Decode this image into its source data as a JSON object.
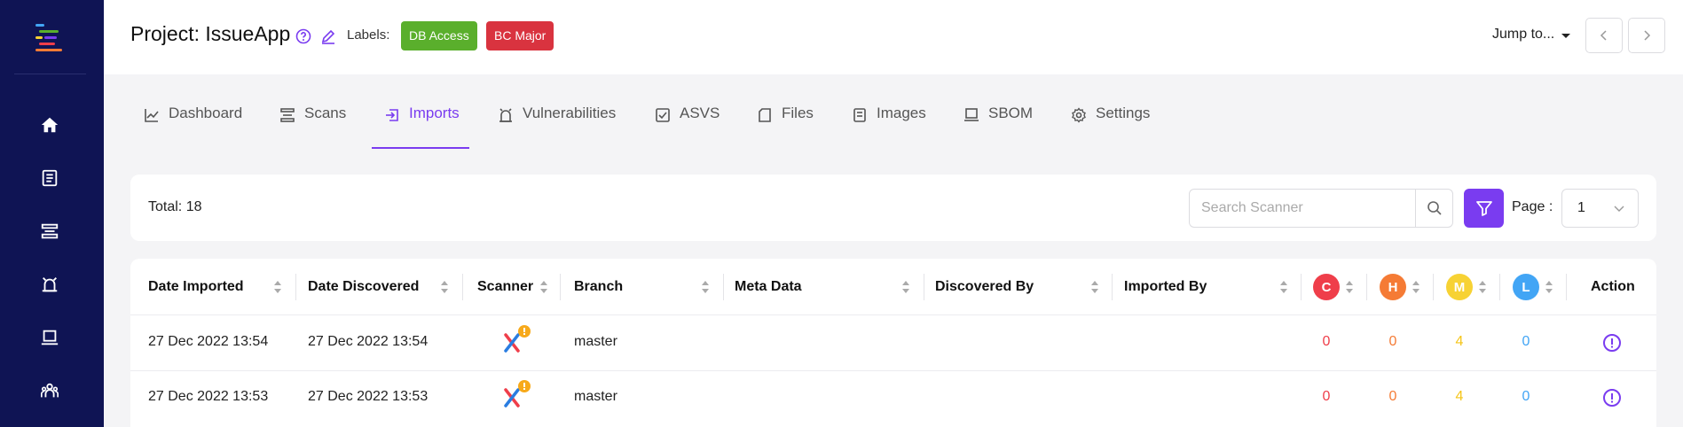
{
  "header": {
    "project_title": "Project: IssueApp",
    "labels_text": "Labels:",
    "badges": [
      {
        "label": "DB Access",
        "color": "#5aaf2c"
      },
      {
        "label": "BC Major",
        "color": "#d9333f"
      }
    ],
    "jump_to": "Jump to..."
  },
  "sidebar": {
    "icons": [
      "home-icon",
      "document-icon",
      "scans-icon",
      "vulnerability-icon",
      "laptop-icon",
      "team-icon"
    ]
  },
  "tabs": [
    {
      "label": "Dashboard",
      "icon": "chart-line-icon"
    },
    {
      "label": "Scans",
      "icon": "scans-icon"
    },
    {
      "label": "Imports",
      "icon": "import-icon",
      "active": true
    },
    {
      "label": "Vulnerabilities",
      "icon": "bug-icon"
    },
    {
      "label": "ASVS",
      "icon": "checkbox-icon"
    },
    {
      "label": "Files",
      "icon": "file-icon"
    },
    {
      "label": "Images",
      "icon": "image-icon"
    },
    {
      "label": "SBOM",
      "icon": "laptop-icon"
    },
    {
      "label": "Settings",
      "icon": "gear-icon"
    }
  ],
  "toolbar": {
    "total": "Total: 18",
    "search_placeholder": "Search Scanner",
    "page_label": "Page :",
    "page_value": "1"
  },
  "table": {
    "columns": [
      "Date Imported",
      "Date Discovered",
      "Scanner",
      "Branch",
      "Meta Data",
      "Discovered By",
      "Imported By",
      "C",
      "H",
      "M",
      "L",
      "Action"
    ],
    "severity_colors": {
      "C": "#ef3e4a",
      "H": "#f57b35",
      "M": "#f7d234",
      "L": "#42a5f5"
    },
    "rows": [
      {
        "date_imported": "27 Dec 2022 13:54",
        "date_discovered": "27 Dec 2022 13:54",
        "branch": "master",
        "c": "0",
        "h": "0",
        "m": "4",
        "l": "0"
      },
      {
        "date_imported": "27 Dec 2022 13:53",
        "date_discovered": "27 Dec 2022 13:53",
        "branch": "master",
        "c": "0",
        "h": "0",
        "m": "4",
        "l": "0"
      }
    ]
  },
  "colors": {
    "sidebar_bg": "#0f1454",
    "accent": "#7a3cf0"
  }
}
